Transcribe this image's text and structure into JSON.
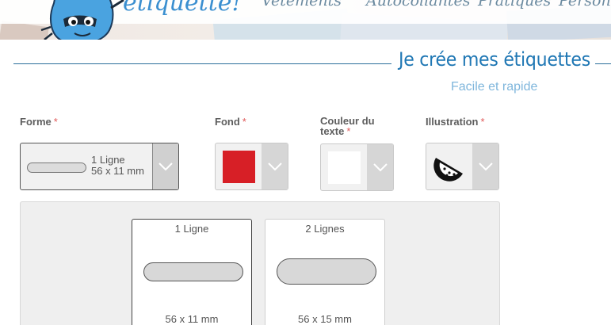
{
  "header": {
    "logo_text": "étiquette!",
    "nav": [
      "Vêtements",
      "Autocollantes",
      "Pratiques",
      "Personn"
    ]
  },
  "title": {
    "main": "Je crée mes étiquettes",
    "subtitle": "Facile et rapide"
  },
  "fields": {
    "forme": {
      "label": "Forme",
      "required": "*",
      "line1": "1 Ligne",
      "line2": "56 x 11 mm"
    },
    "fond": {
      "label": "Fond",
      "required": "*",
      "color": "#d71f26"
    },
    "couleur": {
      "label_line1": "Couleur du",
      "label_line2": "texte",
      "required": "*",
      "color": "#ffffff"
    },
    "illustration": {
      "label": "Illustration",
      "required": "*",
      "icon": "watermelon-icon"
    }
  },
  "dropdown": {
    "options": [
      {
        "name": "1 Ligne",
        "size": "56 x 11 mm",
        "selected": true
      },
      {
        "name": "2 Lignes",
        "size": "56 x 15 mm",
        "selected": false
      }
    ]
  },
  "colors": {
    "accent": "#1f77b4",
    "subtitle": "#7fb6dc",
    "required": "#e05a5a"
  }
}
